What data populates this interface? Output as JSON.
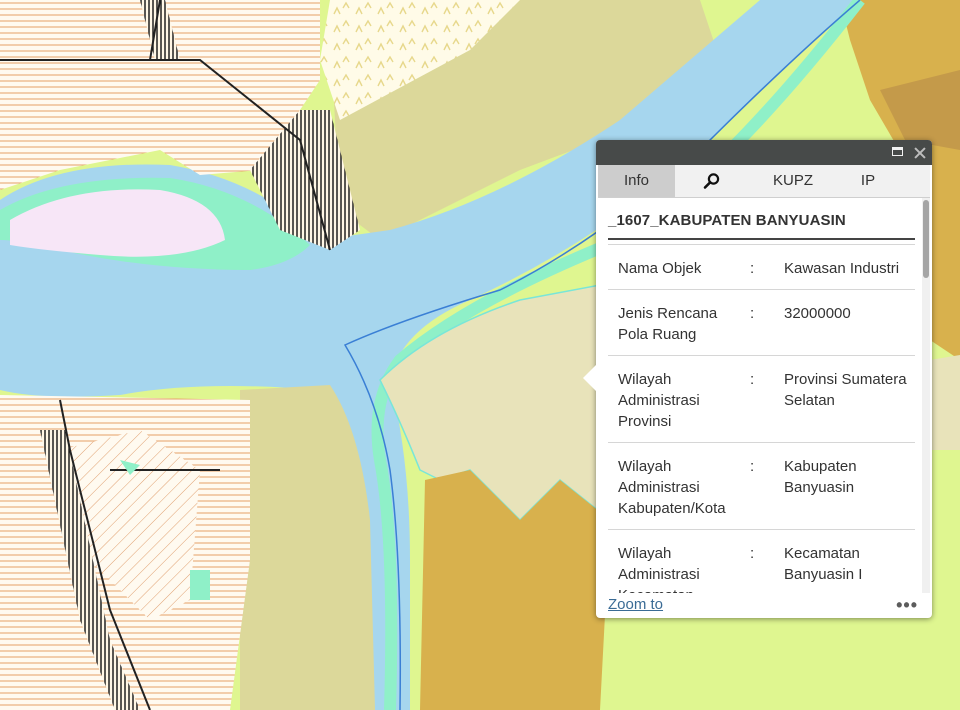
{
  "map": {
    "colors": {
      "river": "#a6d6ee",
      "riverbank": "#8ff0c8",
      "agriculture": "#dcd89a",
      "industrial_zone": "#e8e3ba",
      "settlement": "#d8b14d",
      "plantation": "#dff690",
      "forest": "#c49a4a",
      "protected": "#f7e6f7",
      "hatch": "#e0a070"
    }
  },
  "popup": {
    "maximize_icon": "maximize-icon",
    "close_icon": "close-icon",
    "tabs": [
      {
        "label": "Info",
        "active": true
      },
      {
        "label": "",
        "icon": "search-icon"
      },
      {
        "label": "KUPZ"
      },
      {
        "label": "IP"
      }
    ],
    "layer_title": "_1607_KABUPATEN BANYUASIN",
    "separator": ":",
    "rows": [
      {
        "label": "Nama Objek",
        "value": "Kawasan Industri"
      },
      {
        "label": "Jenis Rencana Pola Ruang",
        "value": "32000000"
      },
      {
        "label": "Wilayah Administrasi Provinsi",
        "value": "Provinsi Sumatera Selatan"
      },
      {
        "label": "Wilayah Administrasi Kabupaten/Kota",
        "value": "Kabupaten Banyuasin"
      },
      {
        "label": "Wilayah Administrasi Kecamatan",
        "value": "Kecamatan Banyuasin I"
      }
    ],
    "zoom_label": "Zoom to",
    "more_label": "•••"
  }
}
